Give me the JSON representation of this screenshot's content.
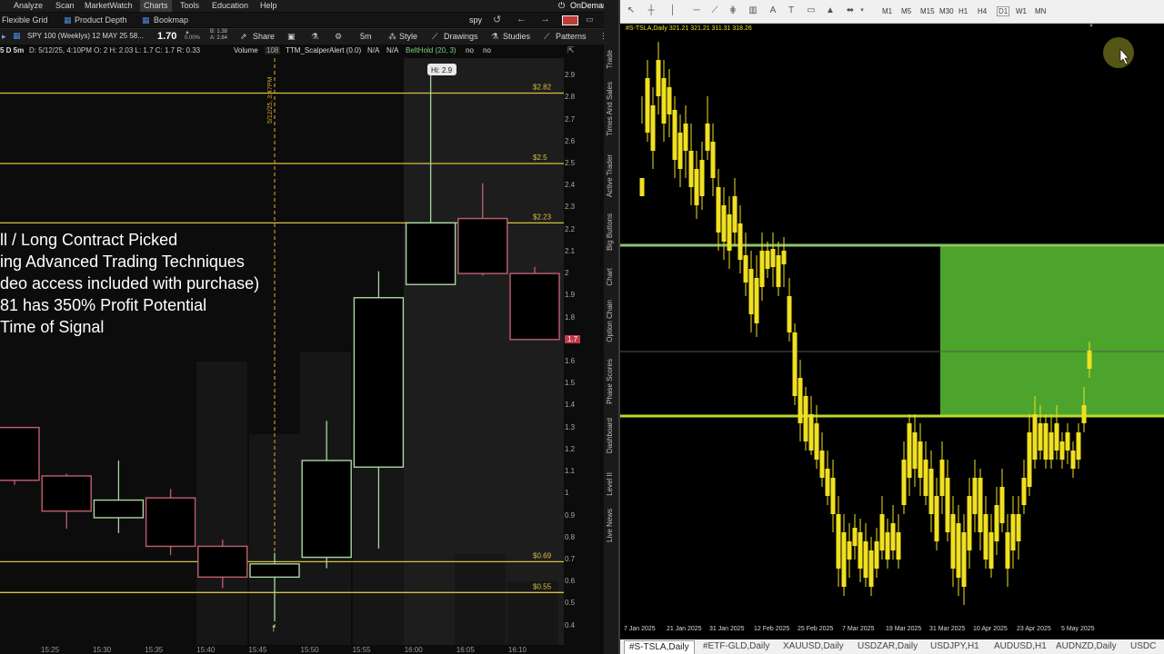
{
  "left": {
    "menu": [
      "Analyze",
      "Scan",
      "MarketWatch",
      "Charts",
      "Tools",
      "Education",
      "Help"
    ],
    "menu_active": "Charts",
    "on_demand": "OnDemand",
    "menu2": [
      "Flexible Grid",
      "Product Depth",
      "Bookmap"
    ],
    "symbol_search": "spy",
    "toolbar": {
      "symbol": "SPY 100 (Weeklys) 12 MAY 25 58...",
      "price": "1.70",
      "change": "0.00%",
      "bid": "B: 1.38",
      "ask": "A: 2.84",
      "share": "Share",
      "timeframe": "5m",
      "style": "Style",
      "drawings": "Drawings",
      "studies": "Studies",
      "patterns": "Patterns"
    },
    "info": {
      "period": "5 D 5m",
      "ohlc": "D: 5/12/25, 4:10PM   O: 2   H: 2.03   L: 1.7   C: 1.7   R: 0.33",
      "volume": "Volume",
      "volume_val": "108",
      "study1": "TTM_ScalperAlert (0.0)",
      "na1": "N/A",
      "na2": "N/A",
      "belthold": "BeltHold (20, 3)",
      "no1": "no",
      "no2": "no"
    },
    "high_label": "Hi: 2.9",
    "vline_label": "5/12/25, 3:47PM",
    "overlay_lines": [
      "ll / Long Contract Picked",
      "ing Advanced Trading Techniques",
      "deo access included with purchase)",
      "81 has 350% Profit Potential",
      "Time of Signal"
    ],
    "price_levels": [
      {
        "label": "$2.82",
        "value": 2.82
      },
      {
        "label": "$2.5",
        "value": 2.5
      },
      {
        "label": "$2.23",
        "value": 2.23
      },
      {
        "label": "$0.69",
        "value": 0.69
      },
      {
        "label": "$0.55",
        "value": 0.55
      }
    ],
    "y_ticks": [
      "2.9",
      "2.8",
      "2.7",
      "2.6",
      "2.5",
      "2.4",
      "2.3",
      "2.2",
      "2.1",
      "2",
      "1.9",
      "1.8",
      "1.7",
      "1.6",
      "1.5",
      "1.4",
      "1.3",
      "1.2",
      "1.1",
      "1",
      "0.9",
      "0.8",
      "0.7",
      "0.6",
      "0.5",
      "0.4"
    ],
    "current_price": "1.7",
    "x_ticks": [
      "15:25",
      "15:30",
      "15:35",
      "15:40",
      "15:45",
      "15:50",
      "15:55",
      "16:00",
      "16:05",
      "16:10"
    ],
    "candles": [
      {
        "o": 1.3,
        "h": 1.3,
        "l": 1.04,
        "c": 1.06,
        "dir": "down"
      },
      {
        "o": 1.08,
        "h": 1.09,
        "l": 0.84,
        "c": 0.92,
        "dir": "down"
      },
      {
        "o": 0.89,
        "h": 1.15,
        "l": 0.82,
        "c": 0.97,
        "dir": "up"
      },
      {
        "o": 0.98,
        "h": 1.02,
        "l": 0.72,
        "c": 0.76,
        "dir": "down"
      },
      {
        "o": 0.76,
        "h": 0.79,
        "l": 0.57,
        "c": 0.62,
        "dir": "down"
      },
      {
        "o": 0.62,
        "h": 0.73,
        "l": 0.42,
        "c": 0.68,
        "dir": "up"
      },
      {
        "o": 0.71,
        "h": 1.33,
        "l": 0.66,
        "c": 1.15,
        "dir": "up"
      },
      {
        "o": 1.12,
        "h": 2.01,
        "l": 0.75,
        "c": 1.89,
        "dir": "up"
      },
      {
        "o": 1.95,
        "h": 2.9,
        "l": 1.95,
        "c": 2.23,
        "dir": "up"
      },
      {
        "o": 2.25,
        "h": 2.41,
        "l": 1.99,
        "c": 2.0,
        "dir": "down"
      },
      {
        "o": 2.0,
        "h": 2.03,
        "l": 1.7,
        "c": 1.7,
        "dir": "down"
      }
    ],
    "side_tabs": [
      "Trade",
      "Times And Sales",
      "Active Trader",
      "Big Buttons",
      "Chart",
      "Option Chain",
      "Phase Scores",
      "Dashboard",
      "Level II",
      "Live News"
    ]
  },
  "right": {
    "timeframes": [
      "M1",
      "M5",
      "M15",
      "M30",
      "H1",
      "H4",
      "D1",
      "W1",
      "MN"
    ],
    "active_timeframe": "D1",
    "ohlc": "#S-TSLA,Daily  321.21 321.21 311.31 318.26",
    "dates": [
      "7 Jan 2025",
      "21 Jan 2025",
      "31 Jan 2025",
      "12 Feb 2025",
      "25 Feb 2025",
      "7 Mar 2025",
      "19 Mar 2025",
      "31 Mar 2025",
      "10 Apr 2025",
      "23 Apr 2025",
      "5 May 2025"
    ],
    "tabs": [
      "#S-TSLA,Daily",
      "#ETF-GLD,Daily",
      "XAUUSD,Daily",
      "USDZAR,Daily",
      "USDJPY,H1",
      "AUDUSD,H1",
      "AUDNZD,Daily",
      "USDC"
    ],
    "active_tab": "#S-TSLA,Daily"
  }
}
